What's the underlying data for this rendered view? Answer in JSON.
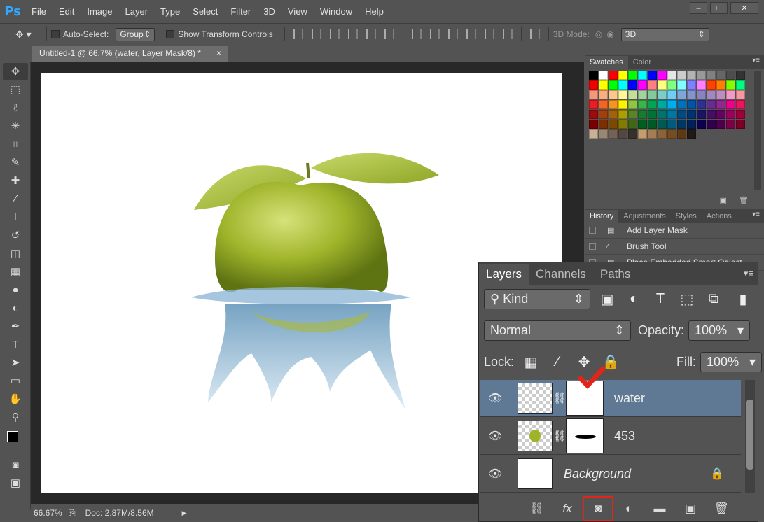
{
  "app": {
    "logo": "Ps",
    "menu": [
      "File",
      "Edit",
      "Image",
      "Layer",
      "Type",
      "Select",
      "Filter",
      "3D",
      "View",
      "Window",
      "Help"
    ],
    "window_controls": {
      "minimize": "–",
      "maximize": "□",
      "close": "✕"
    }
  },
  "options": {
    "tool_icon": "move-tool-icon",
    "auto_select_label": "Auto-Select:",
    "auto_select_value": "Group",
    "show_transform_label": "Show Transform Controls",
    "mode_3d_label": "3D Mode:",
    "mode_3d_value": "3D"
  },
  "document": {
    "tab_title": "Untitled-1 @ 66.7% (water, Layer Mask/8) *",
    "tab_close": "×"
  },
  "status": {
    "zoom": "66.67%",
    "doc_info": "Doc: 2.87M/8.56M",
    "arrow": "▶"
  },
  "swatches_panel": {
    "tabs": [
      "Swatches",
      "Color"
    ],
    "menu": "▾≡",
    "colors": [
      [
        "#000000",
        "#ffffff",
        "#ff0000",
        "#ffff00",
        "#00ff00",
        "#00ffff",
        "#0000ff",
        "#ff00ff",
        "#e6e6e6",
        "#cccccc",
        "#b3b3b3",
        "#999999",
        "#808080",
        "#666666",
        "#4d4d4d",
        "#333333"
      ],
      [
        "#f20000",
        "#ffff00",
        "#00ff00",
        "#00ffff",
        "#0000ff",
        "#ff00ff",
        "#ff8080",
        "#ffff80",
        "#80ff80",
        "#80ffff",
        "#8080ff",
        "#ff80ff",
        "#ff4000",
        "#ff8000",
        "#80ff00",
        "#00ff80"
      ],
      [
        "#f7977a",
        "#f9ad81",
        "#fdc68a",
        "#fff79a",
        "#c4df9b",
        "#a2d39c",
        "#82ca9d",
        "#7bcdc8",
        "#6ecff6",
        "#7ea7d8",
        "#8493ca",
        "#8882be",
        "#a187be",
        "#bc8dbf",
        "#f49ac2",
        "#f6989d"
      ],
      [
        "#ed1c24",
        "#f26522",
        "#f7941d",
        "#fff200",
        "#8dc73f",
        "#39b54a",
        "#00a651",
        "#00a99d",
        "#00aeef",
        "#0072bc",
        "#0054a6",
        "#2e3192",
        "#662d91",
        "#92278f",
        "#ec008c",
        "#ed145b"
      ],
      [
        "#9e0b0f",
        "#a0410d",
        "#a3620a",
        "#aba000",
        "#598527",
        "#1a7b30",
        "#007236",
        "#00746b",
        "#0076a3",
        "#004a80",
        "#003471",
        "#1b1464",
        "#440e62",
        "#630460",
        "#9e005d",
        "#9e0039"
      ],
      [
        "#790000",
        "#7b2e00",
        "#7d4900",
        "#827b00",
        "#406618",
        "#005e20",
        "#005826",
        "#005952",
        "#005b7f",
        "#003663",
        "#002157",
        "#0d004c",
        "#32004b",
        "#4b0049",
        "#7b0046",
        "#7a0026"
      ],
      [
        "#c7b299",
        "#998675",
        "#736357",
        "#534741",
        "#37302a",
        "#c69c6d",
        "#a67c52",
        "#8c6239",
        "#754c24",
        "#603913",
        "#1f1a17"
      ]
    ]
  },
  "history_panel": {
    "tabs": [
      "History",
      "Adjustments",
      "Styles",
      "Actions"
    ],
    "items": [
      {
        "label": "Add Layer Mask",
        "icon": "document-icon"
      },
      {
        "label": "Brush Tool",
        "icon": "brush-icon"
      },
      {
        "label": "Place Embedded Smart Object",
        "icon": "document-icon"
      }
    ]
  },
  "layers_panel": {
    "tabs": [
      "Layers",
      "Channels",
      "Paths"
    ],
    "filter_label": "Kind",
    "blend_mode": "Normal",
    "opacity_label": "Opacity:",
    "opacity_value": "100%",
    "lock_label": "Lock:",
    "fill_label": "Fill:",
    "fill_value": "100%",
    "layers": [
      {
        "name": "water",
        "selected": true,
        "visible": true
      },
      {
        "name": "453",
        "selected": false,
        "visible": true
      },
      {
        "name": "Background",
        "selected": false,
        "visible": true,
        "locked": true
      }
    ],
    "footer_buttons": [
      "link-icon",
      "fx-icon",
      "add-mask-icon",
      "adjustment-icon",
      "folder-icon",
      "new-layer-icon",
      "trash-icon"
    ],
    "fx_label": "fx"
  },
  "annotation": {
    "checkmark_color": "#e1251b",
    "highlight_color": "#e1251b"
  }
}
